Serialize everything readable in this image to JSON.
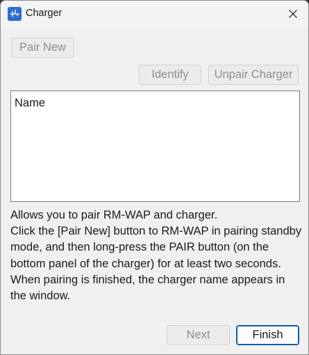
{
  "window": {
    "title": "Charger",
    "icon": "equalizer-app-icon",
    "close_icon": "close-icon"
  },
  "buttons": {
    "pair_new": "Pair New",
    "identify": "Identify",
    "unpair_charger": "Unpair Charger",
    "next": "Next",
    "finish": "Finish"
  },
  "list": {
    "column_header": "Name",
    "items": []
  },
  "description": {
    "lines": [
      "Allows you to pair RM-WAP and charger.",
      "Click the [Pair New] button to RM-WAP in pairing standby mode, and then long-press the PAIR button (on the bottom panel of the charger) for at least two seconds.",
      "When pairing is finished, the charger name appears in the window."
    ]
  },
  "colors": {
    "accent": "#0f5ea8",
    "app_icon_bg": "#2c6dd0",
    "disabled_text": "#8e8e8e"
  }
}
